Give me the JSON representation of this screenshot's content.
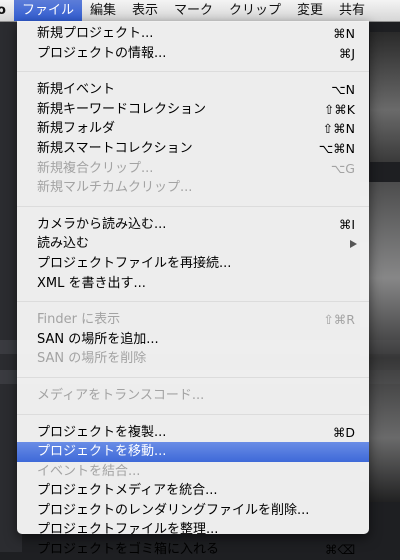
{
  "menubar": {
    "items": [
      "o",
      "ファイル",
      "編集",
      "表示",
      "マーク",
      "クリップ",
      "変更",
      "共有"
    ]
  },
  "menu": {
    "groups": [
      [
        {
          "label": "新規プロジェクト...",
          "shortcut": "⌘N",
          "enabled": true
        },
        {
          "label": "プロジェクトの情報...",
          "shortcut": "⌘J",
          "enabled": true
        }
      ],
      [
        {
          "label": "新規イベント",
          "shortcut": "⌥N",
          "enabled": true
        },
        {
          "label": "新規キーワードコレクション",
          "shortcut": "⇧⌘K",
          "enabled": true
        },
        {
          "label": "新規フォルダ",
          "shortcut": "⇧⌘N",
          "enabled": true
        },
        {
          "label": "新規スマートコレクション",
          "shortcut": "⌥⌘N",
          "enabled": true
        },
        {
          "label": "新規複合クリップ...",
          "shortcut": "⌥G",
          "enabled": false
        },
        {
          "label": "新規マルチカムクリップ...",
          "shortcut": "",
          "enabled": false
        }
      ],
      [
        {
          "label": "カメラから読み込む...",
          "shortcut": "⌘I",
          "enabled": true
        },
        {
          "label": "読み込む",
          "shortcut": "",
          "enabled": true,
          "submenu": true
        },
        {
          "label": "プロジェクトファイルを再接続...",
          "shortcut": "",
          "enabled": true
        },
        {
          "label": "XML を書き出す...",
          "shortcut": "",
          "enabled": true
        }
      ],
      [
        {
          "label": "Finder に表示",
          "shortcut": "⇧⌘R",
          "enabled": false
        },
        {
          "label": "SAN の場所を追加...",
          "shortcut": "",
          "enabled": true
        },
        {
          "label": "SAN の場所を削除",
          "shortcut": "",
          "enabled": false
        }
      ],
      [
        {
          "label": "メディアをトランスコード...",
          "shortcut": "",
          "enabled": false
        }
      ],
      [
        {
          "label": "プロジェクトを複製...",
          "shortcut": "⌘D",
          "enabled": true
        },
        {
          "label": "プロジェクトを移動...",
          "shortcut": "",
          "enabled": true,
          "highlighted": true
        },
        {
          "label": "イベントを結合...",
          "shortcut": "",
          "enabled": false
        },
        {
          "label": "プロジェクトメディアを統合...",
          "shortcut": "",
          "enabled": true
        },
        {
          "label": "プロジェクトのレンダリングファイルを削除...",
          "shortcut": "",
          "enabled": true
        },
        {
          "label": "プロジェクトファイルを整理...",
          "shortcut": "",
          "enabled": true
        },
        {
          "label": "プロジェクトをゴミ箱に入れる",
          "shortcut": "⌘⌫",
          "enabled": true
        }
      ]
    ]
  }
}
